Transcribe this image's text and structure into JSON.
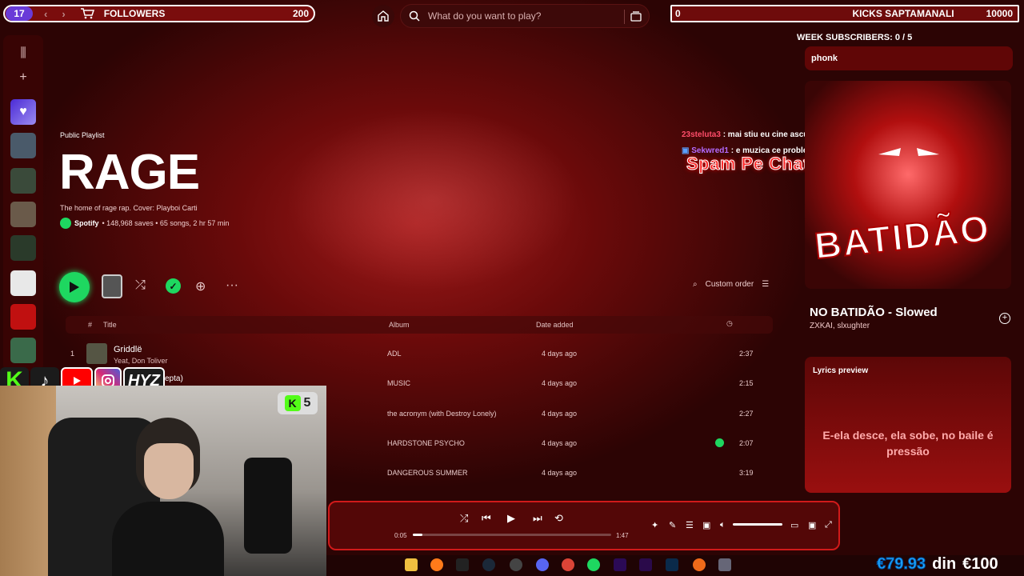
{
  "overlay": {
    "followers_count_badge": "17",
    "followers_label": "FOLLOWERS",
    "followers_value": "200",
    "kicks_left": "0",
    "kicks_label": "KICKS SAPTAMANALI",
    "kicks_value": "10000",
    "week_subscribers": "WEEK SUBSCRIBERS: 0 / 5"
  },
  "search": {
    "placeholder": "What do you want to play?"
  },
  "playlist": {
    "type": "Public Playlist",
    "title": "RAGE",
    "description": "The home of rage rap. Cover: Playboi Carti",
    "owner": "Spotify",
    "meta": "• 148,968 saves • 65 songs, 2 hr 57 min",
    "sort_label": "Custom order"
  },
  "table": {
    "headers": {
      "num": "#",
      "title": "Title",
      "album": "Album",
      "date": "Date added"
    },
    "rows": [
      {
        "num": "1",
        "title": "Griddlë",
        "artist": "Yeat, Don Toliver",
        "album": "ADL",
        "date": "4 days ago",
        "duration": "2:37"
      },
      {
        "num": "",
        "title": "",
        "artist": "epta)",
        "album": "MUSIC",
        "date": "4 days ago",
        "duration": "2:15"
      },
      {
        "num": "",
        "title": "",
        "artist": "",
        "album": "the acronym (with Destroy Lonely)",
        "date": "4 days ago",
        "duration": "2:27"
      },
      {
        "num": "",
        "title": "",
        "artist": "",
        "album": "HARDSTONE PSYCHO",
        "date": "4 days ago",
        "duration": "2:07",
        "saved": true
      },
      {
        "num": "",
        "title": "",
        "artist": "",
        "album": "DANGEROUS SUMMER",
        "date": "4 days ago",
        "duration": "3:19"
      }
    ]
  },
  "chat": [
    {
      "user": "23steluta3",
      "message": ": mai stiu eu cine asculta asta",
      "user_color": "#ff4d6a"
    },
    {
      "user": "Sekwred1",
      "message": ": e muzica ce problema ai?",
      "user_color": "#b36bff"
    }
  ],
  "spam_banner": "Spam Pe Chat cu Emote-uri!",
  "right_panel": {
    "playlist_name": "phonk",
    "cover_text": "BATIDÃO",
    "song_title": "NO BATIDÃO - Slowed",
    "song_artist": "ZXKAI, slxughter",
    "lyrics_title": "Lyrics preview",
    "lyrics_line": "E-ela desce, ela sobe, no baile é pressão"
  },
  "player": {
    "elapsed": "0:05",
    "total": "1:47",
    "progress": 0.05,
    "volume": 1.0
  },
  "socials": {
    "hyz": "HYZ",
    "kick_badge": "5"
  },
  "money": {
    "current": "€79.93",
    "din": "din",
    "goal": "€100"
  },
  "colors": {
    "accent": "#e01f1f",
    "spotify_green": "#1ed760",
    "kick_green": "#53fc18"
  }
}
